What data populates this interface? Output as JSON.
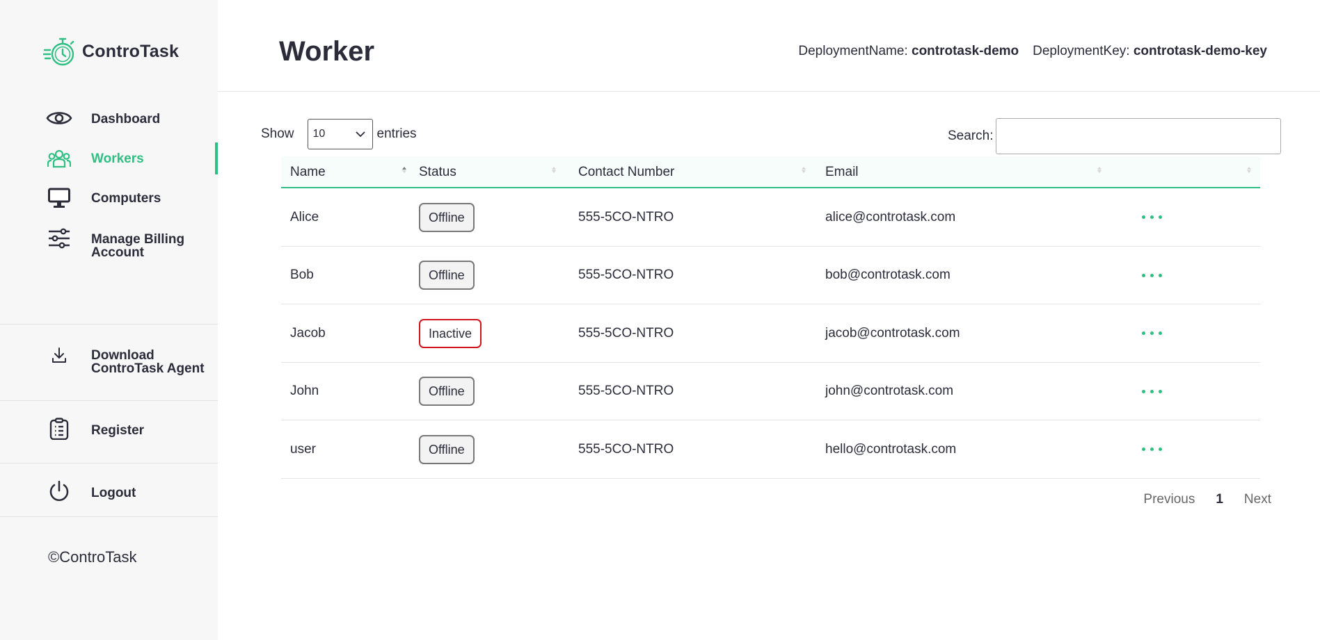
{
  "app": {
    "name": "ControTask",
    "copyright": "©ControTask"
  },
  "colors": {
    "accent": "#2fbf83",
    "inactive_border": "#d0121b",
    "text": "#2b2b3a"
  },
  "sidebar": {
    "items": [
      {
        "label": "Dashboard",
        "icon": "eye-icon"
      },
      {
        "label": "Workers",
        "icon": "users-icon",
        "active": true
      },
      {
        "label": "Computers",
        "icon": "monitor-icon"
      },
      {
        "label": "Manage Billing Account",
        "icon": "sliders-icon"
      }
    ],
    "download": {
      "label": "Download ControTask Agent",
      "icon": "download-icon"
    },
    "register": {
      "label": "Register",
      "icon": "clipboard-icon"
    },
    "logout": {
      "label": "Logout",
      "icon": "power-icon"
    }
  },
  "header": {
    "title": "Worker",
    "deployment_name_label": "DeploymentName:",
    "deployment_name": "controtask-demo",
    "deployment_key_label": "DeploymentKey:",
    "deployment_key": "controtask-demo-key"
  },
  "controls": {
    "show_label": "Show",
    "entries_value": "10",
    "entries_label": "entries",
    "search_label": "Search:",
    "search_value": ""
  },
  "table": {
    "columns": [
      "Name",
      "Status",
      "Contact Number",
      "Email",
      ""
    ],
    "rows": [
      {
        "name": "Alice",
        "status": "Offline",
        "contact": "555-5CO-NTRO",
        "email": "alice@controtask.com"
      },
      {
        "name": "Bob",
        "status": "Offline",
        "contact": "555-5CO-NTRO",
        "email": "bob@controtask.com"
      },
      {
        "name": "Jacob",
        "status": "Inactive",
        "contact": "555-5CO-NTRO",
        "email": "jacob@controtask.com"
      },
      {
        "name": "John",
        "status": "Offline",
        "contact": "555-5CO-NTRO",
        "email": "john@controtask.com"
      },
      {
        "name": "user",
        "status": "Offline",
        "contact": "555-5CO-NTRO",
        "email": "hello@controtask.com"
      }
    ]
  },
  "pagination": {
    "previous": "Previous",
    "current": "1",
    "next": "Next"
  }
}
